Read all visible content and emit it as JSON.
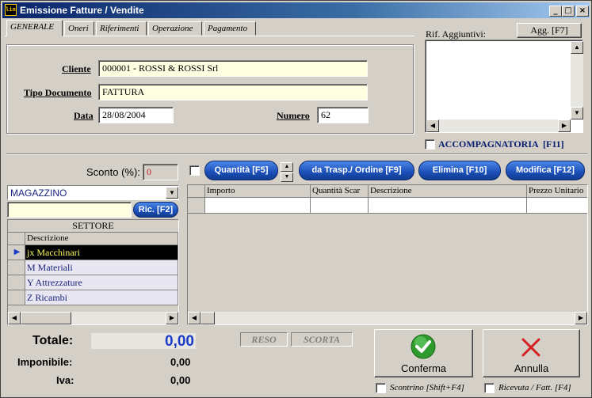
{
  "window": {
    "title": "Emissione Fatture / Vendite",
    "app_icon_text": "lin"
  },
  "tabs": [
    {
      "label": "GENERALE"
    },
    {
      "label": "Oneri"
    },
    {
      "label": "Riferimenti"
    },
    {
      "label": "Operazione"
    },
    {
      "label": "Pagamento"
    }
  ],
  "form": {
    "cliente_label": "Cliente",
    "cliente_value": "000001 - ROSSI & ROSSI Srl",
    "tipo_label": "Tipo Documento",
    "tipo_value": "FATTURA",
    "data_label": "Data",
    "data_value": "28/08/2004",
    "numero_label": "Numero",
    "numero_value": "62"
  },
  "rif": {
    "label": "Rif. Aggiuntivi:",
    "agg_button": "Agg. [F7]",
    "accompagnatoria_label": "ACCOMPAGNATORIA  [F11]"
  },
  "sconto": {
    "label": "Sconto (%):",
    "value": "0"
  },
  "magazzino": {
    "selected": "MAGAZZINO",
    "ric_button": "Ric. [F2]"
  },
  "settore": {
    "title": "SETTORE",
    "column": "Descrizione",
    "rows": [
      "jx Macchinari",
      "M Materiali",
      "Y Attrezzature",
      "Z Ricambi"
    ]
  },
  "toolbar": {
    "quantita": "Quantità [F5]",
    "trasp": "da Trasp./ Ordine [F9]",
    "elimina": "Elimina [F10]",
    "modifica": "Modifica [F12]"
  },
  "righe": {
    "columns": [
      "Importo",
      "Quantità Scar",
      "Descrizione",
      "Prezzo Unitario"
    ]
  },
  "totali": {
    "totale_label": "Totale:",
    "totale_value": "0,00",
    "imponibile_label": "Imponibile:",
    "imponibile_value": "0,00",
    "iva_label": "Iva:",
    "iva_value": "0,00",
    "reso_label": "RESO",
    "scorta_label": "SCORTA"
  },
  "actions": {
    "conferma": "Conferma",
    "annulla": "Annulla",
    "scontrino": "Scontrino [Shift+F4]",
    "ricevuta": "Ricevuta / Fatt. [F4]"
  },
  "colors": {
    "title_gradient_start": "#0a246a",
    "pill_blue": "#1b4fb8",
    "total_blue": "#1a3cc8",
    "selected_row": "#000000",
    "field_yellow": "#ffffe1"
  }
}
